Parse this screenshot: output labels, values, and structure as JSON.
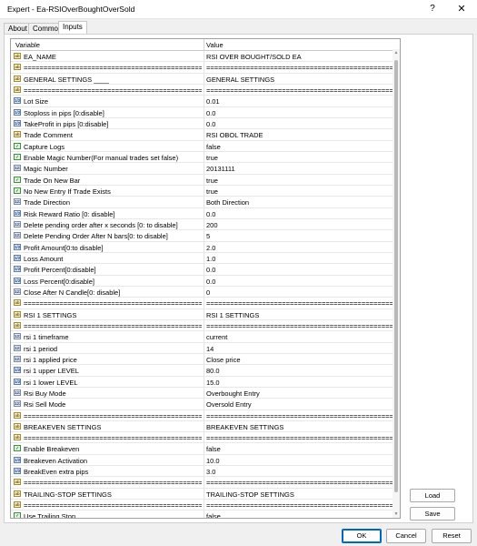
{
  "window": {
    "title": "Expert - Ea-RSIOverBoughtOverSold",
    "help_label": "?",
    "close_label": "✕"
  },
  "tabs": [
    {
      "label": "About"
    },
    {
      "label": "Common"
    },
    {
      "label": "Inputs"
    }
  ],
  "grid": {
    "headers": {
      "variable": "Variable",
      "value": "Value"
    },
    "rows": [
      {
        "icon": "ab",
        "variable": "EA_NAME",
        "value": "RSI OVER BOUGHT/SOLD EA"
      },
      {
        "icon": "ab",
        "variable": "=====================================================",
        "value": "================================================"
      },
      {
        "icon": "ab",
        "variable": "GENERAL SETTINGS ____",
        "value": "GENERAL SETTINGS"
      },
      {
        "icon": "ab",
        "variable": "=====================================================",
        "value": "================================================"
      },
      {
        "icon": "dbl",
        "variable": "Lot Size",
        "value": "0.01"
      },
      {
        "icon": "dbl",
        "variable": "Stoploss in pips [0:disable]",
        "value": "0.0"
      },
      {
        "icon": "dbl",
        "variable": "TakeProfit in pips [0:disable]",
        "value": "0.0"
      },
      {
        "icon": "ab",
        "variable": "Trade Comment",
        "value": "RSI OBOL TRADE"
      },
      {
        "icon": "bool",
        "variable": "Capture Logs",
        "value": "false"
      },
      {
        "icon": "bool",
        "variable": "Enable Magic Number(For manual trades set false)",
        "value": "true"
      },
      {
        "icon": "int",
        "variable": "Magic Number",
        "value": "20131111"
      },
      {
        "icon": "bool",
        "variable": "Trade On New Bar",
        "value": "true"
      },
      {
        "icon": "bool",
        "variable": "No New Entry If Trade Exists",
        "value": "true"
      },
      {
        "icon": "int",
        "variable": "Trade Direction",
        "value": "Both Direction"
      },
      {
        "icon": "dbl",
        "variable": "Risk Reward Ratio [0: disable]",
        "value": "0.0"
      },
      {
        "icon": "int",
        "variable": "Delete pending order after x seconds [0: to disable]",
        "value": "200"
      },
      {
        "icon": "int",
        "variable": "Delete Pending Order After N bars[0: to disable]",
        "value": "5"
      },
      {
        "icon": "dbl",
        "variable": "Profit Amount[0:to disable]",
        "value": "2.0"
      },
      {
        "icon": "dbl",
        "variable": "Loss Amount",
        "value": "1.0"
      },
      {
        "icon": "dbl",
        "variable": "Profit Percent[0:disable]",
        "value": "0.0"
      },
      {
        "icon": "dbl",
        "variable": "Loss Percent[0:disable]",
        "value": "0.0"
      },
      {
        "icon": "int",
        "variable": "Close After N Candle[0: disable]",
        "value": "0"
      },
      {
        "icon": "ab",
        "variable": "=====================================================",
        "value": "================================================"
      },
      {
        "icon": "ab",
        "variable": "RSI 1 SETTINGS",
        "value": " RSI 1 SETTINGS"
      },
      {
        "icon": "ab",
        "variable": "=====================================================",
        "value": "================================================"
      },
      {
        "icon": "int",
        "variable": "rsi 1 timeframe",
        "value": "current"
      },
      {
        "icon": "int",
        "variable": "rsi 1 period",
        "value": "14"
      },
      {
        "icon": "int",
        "variable": "rsi 1 applied price",
        "value": "Close price"
      },
      {
        "icon": "dbl",
        "variable": "rsi 1 upper LEVEL",
        "value": "80.0"
      },
      {
        "icon": "dbl",
        "variable": "rsi 1 lower LEVEL",
        "value": "15.0"
      },
      {
        "icon": "int",
        "variable": "Rsi Buy Mode",
        "value": "Overbought Entry"
      },
      {
        "icon": "int",
        "variable": "Rsi Sell Mode",
        "value": "Oversold Entry"
      },
      {
        "icon": "ab",
        "variable": "=====================================================",
        "value": "================================================"
      },
      {
        "icon": "ab",
        "variable": "BREAKEVEN SETTINGS",
        "value": "BREAKEVEN SETTINGS"
      },
      {
        "icon": "ab",
        "variable": "=====================================================",
        "value": "================================================"
      },
      {
        "icon": "bool",
        "variable": "Enable Breakeven",
        "value": "false"
      },
      {
        "icon": "dbl",
        "variable": "Breakeven Activation",
        "value": "10.0"
      },
      {
        "icon": "dbl",
        "variable": "BreakEven extra pips",
        "value": "3.0"
      },
      {
        "icon": "ab",
        "variable": "=====================================================",
        "value": "================================================"
      },
      {
        "icon": "ab",
        "variable": "TRAILING-STOP SETTINGS",
        "value": "TRAILING-STOP SETTINGS"
      },
      {
        "icon": "ab",
        "variable": "=====================================================",
        "value": "================================================"
      },
      {
        "icon": "bool",
        "variable": "Use Trailing Stop",
        "value": "false"
      }
    ]
  },
  "icon_labels": {
    "ab": "ab",
    "dbl": "1/2",
    "int": "123",
    "bool": "✓"
  },
  "side_buttons": {
    "load_label": "Load",
    "save_label": "Save"
  },
  "footer": {
    "ok_label": "OK",
    "cancel_label": "Cancel",
    "reset_label": "Reset"
  }
}
